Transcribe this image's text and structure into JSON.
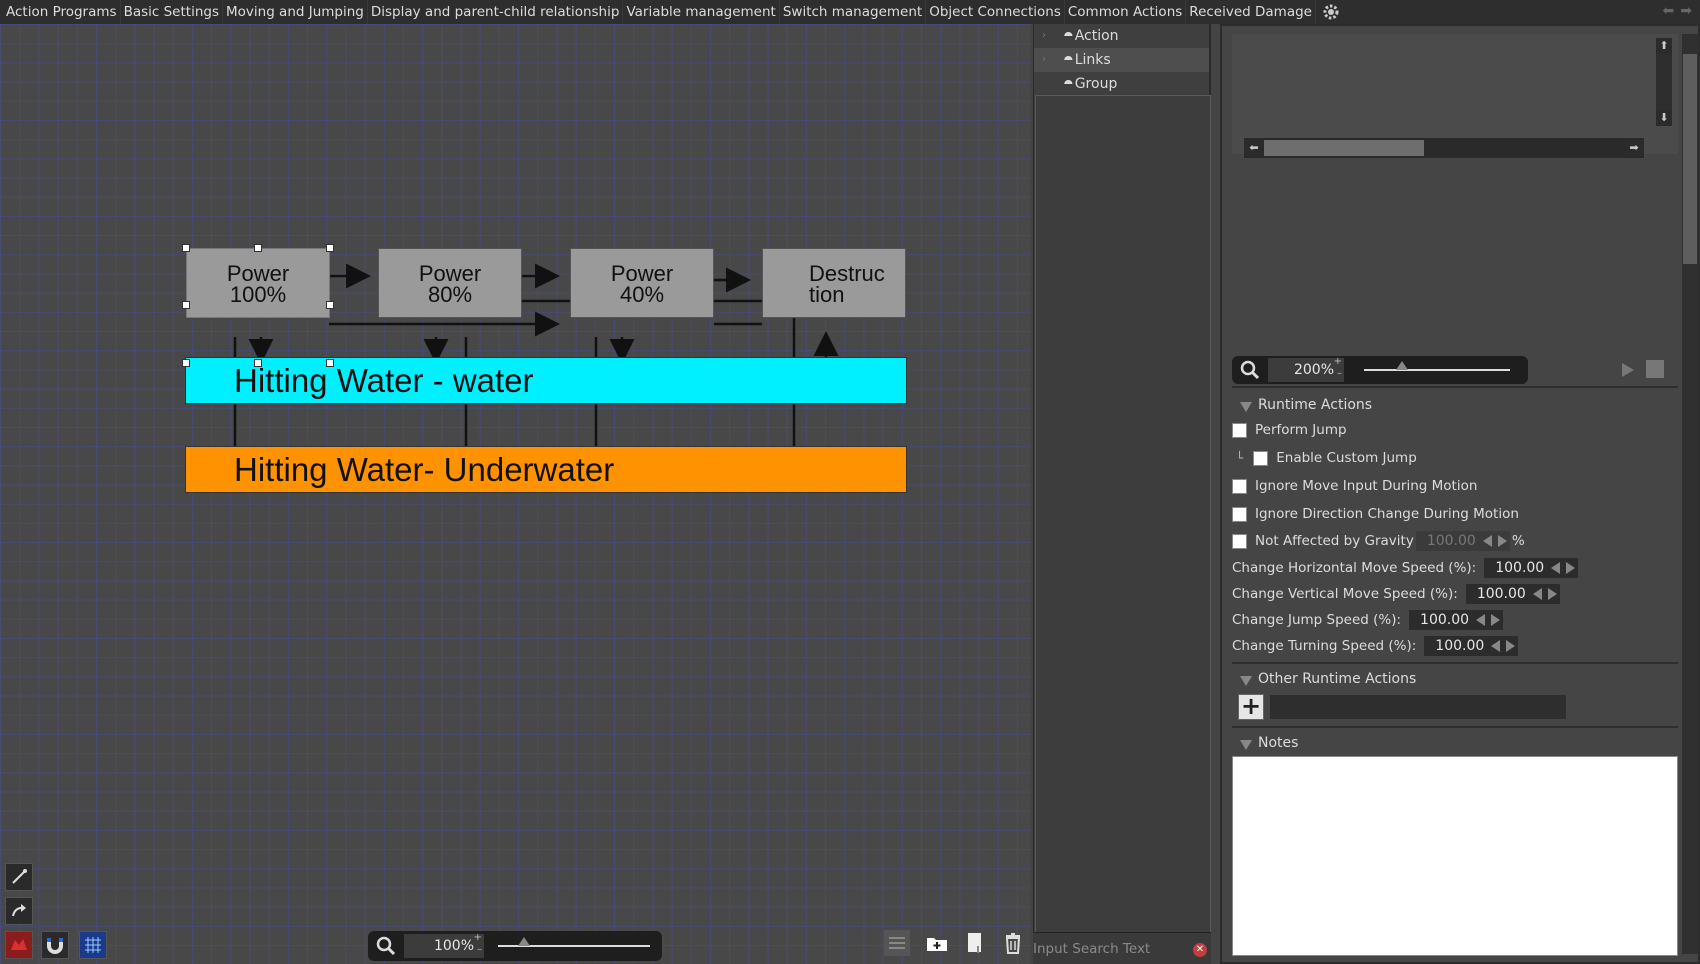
{
  "tabs": [
    "Action Programs",
    "Basic Settings",
    "Moving and Jumping",
    "Display and parent-child relationship",
    "Variable management",
    "Switch management",
    "Object Connections",
    "Common Actions",
    "Received Damage"
  ],
  "canvas": {
    "nodes": [
      {
        "line1": "Power",
        "line2": "100%"
      },
      {
        "line1": "Power",
        "line2": "80%"
      },
      {
        "line1": "Power",
        "line2": "40%"
      },
      {
        "line1": "Destruc",
        "line2": "tion"
      }
    ],
    "band_water": "Hitting Water - water",
    "band_underwater": "Hitting Water- Underwater",
    "zoom": "100%"
  },
  "tree": {
    "items": [
      "Action",
      "Links",
      "Group"
    ],
    "search_placeholder": "Input Search Text"
  },
  "preview": {
    "zoom": "200%"
  },
  "runtime": {
    "title": "Runtime Actions",
    "perform_jump": "Perform Jump",
    "enable_custom_jump": "Enable Custom Jump",
    "ignore_move": "Ignore Move Input During Motion",
    "ignore_direction": "Ignore Direction Change During Motion",
    "gravity": "Not Affected by Gravity",
    "gravity_value": "100.00",
    "gravity_unit": "%",
    "h_speed": "Change Horizontal Move Speed (%):",
    "h_speed_value": "100.00",
    "v_speed": "Change Vertical Move Speed (%):",
    "v_speed_value": "100.00",
    "jump_speed": "Change Jump Speed (%):",
    "jump_speed_value": "100.00",
    "turn_speed": "Change Turning Speed (%):",
    "turn_speed_value": "100.00"
  },
  "other": {
    "title": "Other Runtime Actions",
    "add": "+"
  },
  "notes": {
    "title": "Notes"
  },
  "colors": {
    "water": "#00f0ff",
    "underwater": "#ff9200",
    "node": "#9a9a9a"
  }
}
